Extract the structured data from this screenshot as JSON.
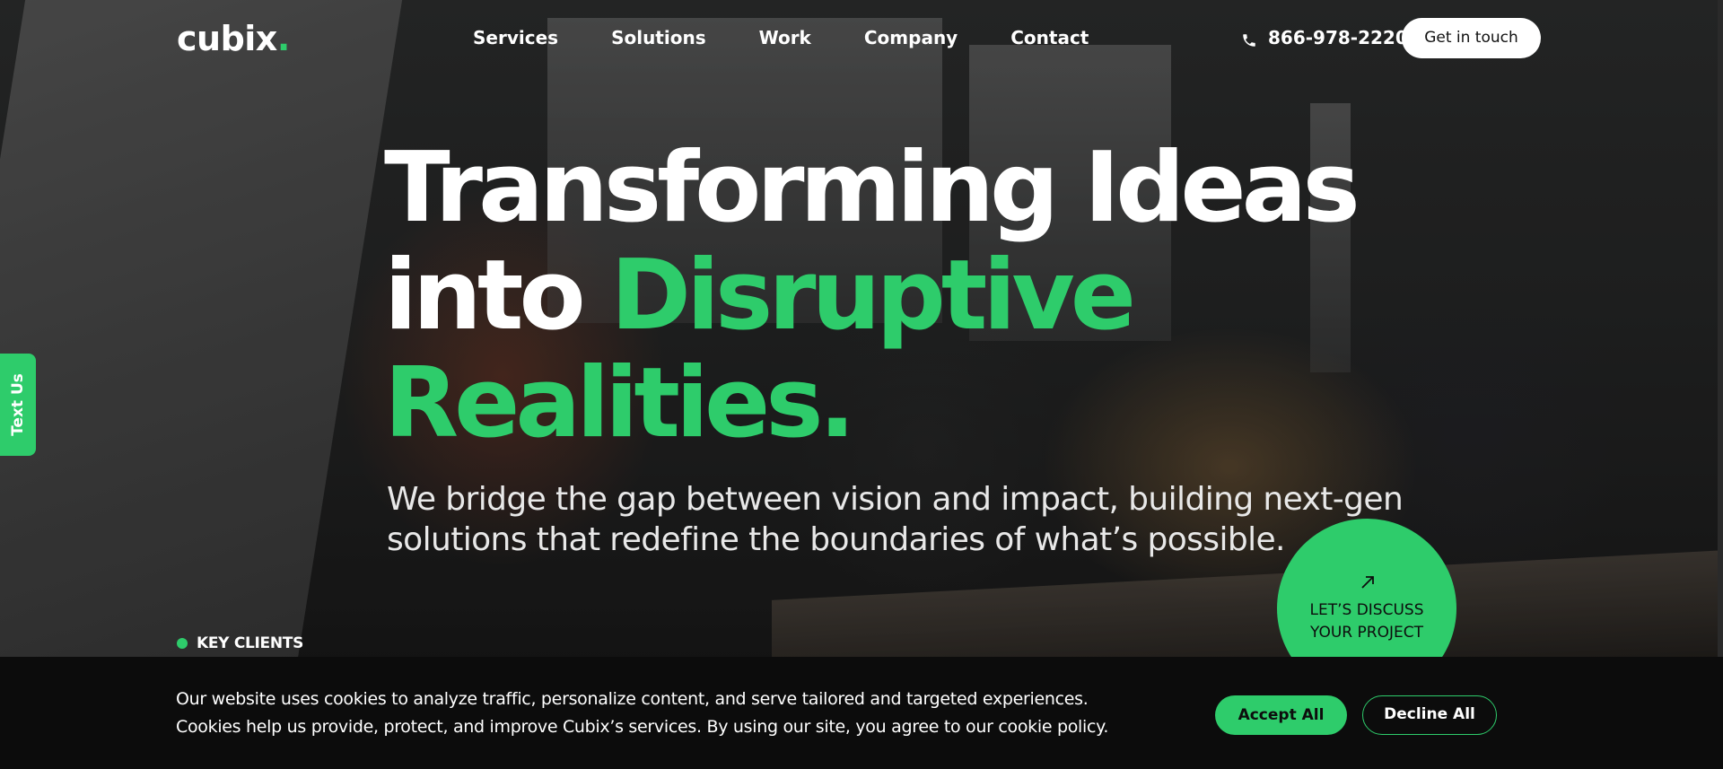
{
  "header": {
    "logo_text": "cubix",
    "logo_dot": ".",
    "nav": [
      {
        "label": "Services"
      },
      {
        "label": "Solutions"
      },
      {
        "label": "Work"
      },
      {
        "label": "Company"
      },
      {
        "label": "Contact"
      }
    ],
    "phone": "866-978-2220",
    "cta_label": "Get in touch"
  },
  "side_tab": {
    "label": "Text Us"
  },
  "hero": {
    "line1": "Transforming Ideas",
    "line2_white": "into",
    "line2_green": "Disruptive",
    "line3_green": "Realities.",
    "subtitle": "We bridge the gap between vision and impact, building next-gen solutions that redefine the boundaries of what’s possible.",
    "discuss_line1": "LET’S DISCUSS",
    "discuss_line2": "YOUR PROJECT",
    "key_clients": "KEY CLIENTS"
  },
  "cookie": {
    "line1": "Our website uses cookies to analyze traffic, personalize content, and serve tailored and targeted experiences.",
    "line2": "Cookies help us provide, protect, and improve Cubix’s services. By using our site, you agree to our cookie policy.",
    "accept_label": "Accept All",
    "decline_label": "Decline All"
  },
  "colors": {
    "accent": "#2ecc6b",
    "background": "#0c0c0c",
    "text": "#ffffff"
  },
  "icons": {
    "phone": "phone-icon",
    "discuss_arrow": "arrow-up-right-icon",
    "key_dot": "dot-icon"
  }
}
